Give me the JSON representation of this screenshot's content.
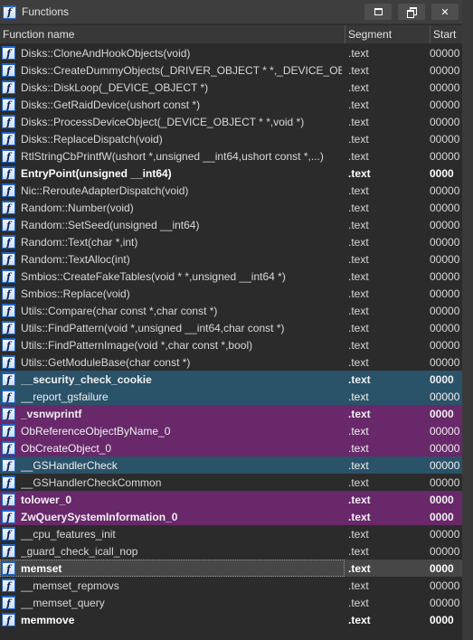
{
  "window": {
    "title": "Functions",
    "buttons": {
      "maximize": "maximize",
      "restore": "restore",
      "close": "✕"
    }
  },
  "columns": {
    "name": "Function name",
    "segment": "Segment",
    "start": "Start"
  },
  "colors": {
    "library_blue": "#2a5268",
    "lumina_purple": "#68286a",
    "selected": "#474747",
    "background": "#2b2b2b"
  },
  "rows": [
    {
      "name": "Disks::CloneAndHookObjects(void)",
      "segment": ".text",
      "start": "00000",
      "style": "",
      "bold": false
    },
    {
      "name": "Disks::CreateDummyObjects(_DRIVER_OBJECT * *,_DEVICE_OBJEC...",
      "segment": ".text",
      "start": "00000",
      "style": "",
      "bold": false
    },
    {
      "name": "Disks::DiskLoop(_DEVICE_OBJECT *)",
      "segment": ".text",
      "start": "00000",
      "style": "",
      "bold": false
    },
    {
      "name": "Disks::GetRaidDevice(ushort const *)",
      "segment": ".text",
      "start": "00000",
      "style": "",
      "bold": false
    },
    {
      "name": "Disks::ProcessDeviceObject(_DEVICE_OBJECT * *,void *)",
      "segment": ".text",
      "start": "00000",
      "style": "",
      "bold": false
    },
    {
      "name": "Disks::ReplaceDispatch(void)",
      "segment": ".text",
      "start": "00000",
      "style": "",
      "bold": false
    },
    {
      "name": "RtlStringCbPrintfW(ushort *,unsigned __int64,ushort const *,...)",
      "segment": ".text",
      "start": "00000",
      "style": "",
      "bold": false
    },
    {
      "name": "EntryPoint(unsigned __int64)",
      "segment": ".text",
      "start": "0000",
      "style": "",
      "bold": true
    },
    {
      "name": "Nic::RerouteAdapterDispatch(void)",
      "segment": ".text",
      "start": "00000",
      "style": "",
      "bold": false
    },
    {
      "name": "Random::Number(void)",
      "segment": ".text",
      "start": "00000",
      "style": "",
      "bold": false
    },
    {
      "name": "Random::SetSeed(unsigned __int64)",
      "segment": ".text",
      "start": "00000",
      "style": "",
      "bold": false
    },
    {
      "name": "Random::Text(char *,int)",
      "segment": ".text",
      "start": "00000",
      "style": "",
      "bold": false
    },
    {
      "name": "Random::TextAlloc(int)",
      "segment": ".text",
      "start": "00000",
      "style": "",
      "bold": false
    },
    {
      "name": "Smbios::CreateFakeTables(void * *,unsigned __int64 *)",
      "segment": ".text",
      "start": "00000",
      "style": "",
      "bold": false
    },
    {
      "name": "Smbios::Replace(void)",
      "segment": ".text",
      "start": "00000",
      "style": "",
      "bold": false
    },
    {
      "name": "Utils::Compare(char const *,char const *)",
      "segment": ".text",
      "start": "00000",
      "style": "",
      "bold": false
    },
    {
      "name": "Utils::FindPattern(void *,unsigned __int64,char const *)",
      "segment": ".text",
      "start": "00000",
      "style": "",
      "bold": false
    },
    {
      "name": "Utils::FindPatternImage(void *,char const *,bool)",
      "segment": ".text",
      "start": "00000",
      "style": "",
      "bold": false
    },
    {
      "name": "Utils::GetModuleBase(char const *)",
      "segment": ".text",
      "start": "00000",
      "style": "",
      "bold": false
    },
    {
      "name": "__security_check_cookie",
      "segment": ".text",
      "start": "0000",
      "style": "blue",
      "bold": true
    },
    {
      "name": "__report_gsfailure",
      "segment": ".text",
      "start": "00000",
      "style": "blue",
      "bold": false
    },
    {
      "name": "_vsnwprintf",
      "segment": ".text",
      "start": "0000",
      "style": "purple",
      "bold": true
    },
    {
      "name": "ObReferenceObjectByName_0",
      "segment": ".text",
      "start": "00000",
      "style": "purple",
      "bold": false
    },
    {
      "name": "ObCreateObject_0",
      "segment": ".text",
      "start": "00000",
      "style": "purple",
      "bold": false
    },
    {
      "name": "__GSHandlerCheck",
      "segment": ".text",
      "start": "00000",
      "style": "blue",
      "bold": false
    },
    {
      "name": "__GSHandlerCheckCommon",
      "segment": ".text",
      "start": "00000",
      "style": "",
      "bold": false
    },
    {
      "name": "tolower_0",
      "segment": ".text",
      "start": "0000",
      "style": "purple",
      "bold": true
    },
    {
      "name": "ZwQuerySystemInformation_0",
      "segment": ".text",
      "start": "0000",
      "style": "purple",
      "bold": true
    },
    {
      "name": "__cpu_features_init",
      "segment": ".text",
      "start": "00000",
      "style": "",
      "bold": false
    },
    {
      "name": "_guard_check_icall_nop",
      "segment": ".text",
      "start": "00000",
      "style": "",
      "bold": false
    },
    {
      "name": "memset",
      "segment": ".text",
      "start": "0000",
      "style": "sel",
      "bold": true
    },
    {
      "name": "__memset_repmovs",
      "segment": ".text",
      "start": "00000",
      "style": "",
      "bold": false
    },
    {
      "name": "__memset_query",
      "segment": ".text",
      "start": "00000",
      "style": "",
      "bold": false
    },
    {
      "name": "memmove",
      "segment": ".text",
      "start": "0000",
      "style": "",
      "bold": true
    }
  ]
}
